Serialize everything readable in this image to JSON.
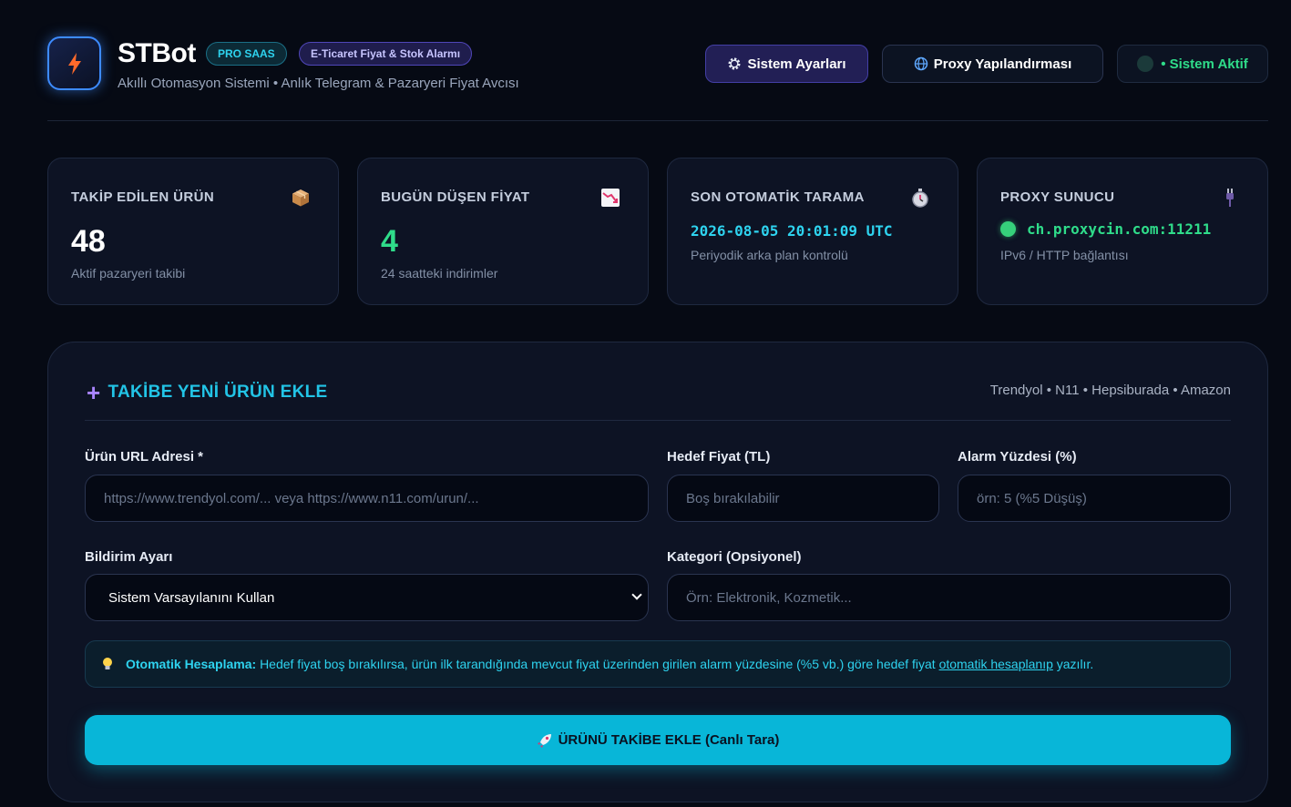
{
  "header": {
    "brand": "STBot",
    "badge_pro": "PRO SAAS",
    "badge_ecom": "E-Ticaret Fiyat & Stok Alarmı",
    "subtitle": "Akıllı Otomasyon Sistemi • Anlık Telegram & Pazaryeri Fiyat Avcısı",
    "settings_label": "Sistem Ayarları",
    "proxy_label": "Proxy Yapılandırması",
    "status_label": "• Sistem Aktif"
  },
  "stats": [
    {
      "label": "TAKİP EDİLEN ÜRÜN",
      "value": "48",
      "foot": "Aktif pazaryeri takibi",
      "icon": "package-icon"
    },
    {
      "label": "BUGÜN DÜŞEN FİYAT",
      "value": "4",
      "foot": "24 saatteki indirimler",
      "icon": "chart-down-icon"
    },
    {
      "label": "SON OTOMATİK TARAMA",
      "value": "2026-08-05 20:01:09 UTC",
      "foot": "Periyodik arka plan kontrolü",
      "icon": "stopwatch-icon"
    },
    {
      "label": "PROXY SUNUCU",
      "value": "ch.proxycin.com:11211",
      "foot": "IPv6 / HTTP bağlantısı",
      "icon": "plug-icon"
    }
  ],
  "form": {
    "title": "TAKİBE YENİ ÜRÜN EKLE",
    "markets": "Trendyol • N11 • Hepsiburada • Amazon",
    "url_label": "Ürün URL Adresi *",
    "url_placeholder": "https://www.trendyol.com/... veya https://www.n11.com/urun/...",
    "target_label": "Hedef Fiyat (TL)",
    "target_placeholder": "Boş bırakılabilir",
    "alarm_label": "Alarm Yüzdesi (%)",
    "alarm_placeholder": "örn: 5 (%5 Düşüş)",
    "notify_label": "Bildirim Ayarı",
    "notify_value": "Sistem Varsayılanını Kullan",
    "category_label": "Kategori (Opsiyonel)",
    "category_placeholder": "Örn: Elektronik, Kozmetik...",
    "info_bold": "Otomatik Hesaplama:",
    "info_text": "Hedef fiyat boş bırakılırsa, ürün ilk tarandığında mevcut fiyat üzerinden girilen alarm yüzdesine (%5 vb.) göre hedef fiyat",
    "info_link": "otomatik hesaplanıp",
    "info_end": "yazılır.",
    "submit_label": "ÜRÜNÜ TAKİBE EKLE (Canlı Tara)"
  },
  "colors": {
    "accent_cyan": "#08b6d8",
    "accent_green": "#2fdc8a",
    "accent_purple": "#a985ff",
    "background": "#060a14"
  }
}
